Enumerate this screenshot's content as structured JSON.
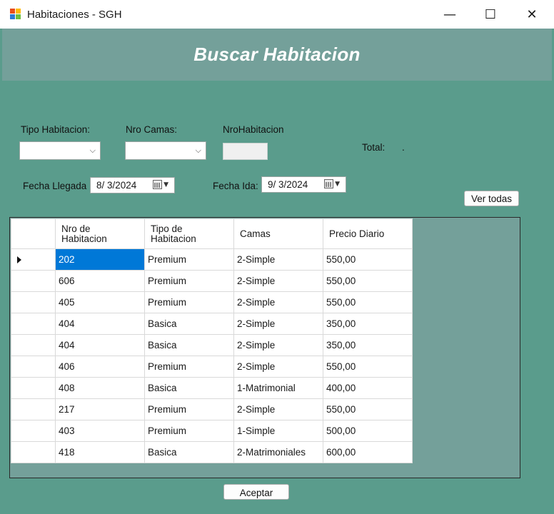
{
  "window": {
    "title": "Habitaciones - SGH",
    "minimize_glyph": "—",
    "maximize_glyph": "☐",
    "close_glyph": "✕",
    "icon_colors": [
      "#e84e1b",
      "#ffb900",
      "#2b7bd6",
      "#6fbf3f"
    ]
  },
  "banner": {
    "title": "Buscar Habitacion"
  },
  "filters": {
    "tipo_label": "Tipo Habitacion:",
    "camas_label": "Nro Camas:",
    "nro_label": "NroHabitacion",
    "total_label": "Total:",
    "total_value": ".",
    "llegada_label": "Fecha Llegada",
    "llegada_value": "8/  3/2024",
    "ida_label": "Fecha Ida:",
    "ida_value": "9/  3/2024",
    "combo_arrow": "⌵"
  },
  "buttons": {
    "ver_todas": "Ver todas",
    "aceptar": "Aceptar"
  },
  "table": {
    "headers": [
      "Nro de\nHabitacion",
      "Tipo de\nHabitacion",
      "Camas",
      "Precio Diario"
    ],
    "rows": [
      [
        "202",
        "Premium",
        "2-Simple",
        "550,00"
      ],
      [
        "606",
        "Premium",
        "2-Simple",
        "550,00"
      ],
      [
        "405",
        "Premium",
        "2-Simple",
        "550,00"
      ],
      [
        "404",
        "Basica",
        "2-Simple",
        "350,00"
      ],
      [
        "404",
        "Basica",
        "2-Simple",
        "350,00"
      ],
      [
        "406",
        "Premium",
        "2-Simple",
        "550,00"
      ],
      [
        "408",
        "Basica",
        "1-Matrimonial",
        "400,00"
      ],
      [
        "217",
        "Premium",
        "2-Simple",
        "550,00"
      ],
      [
        "403",
        "Premium",
        "1-Simple",
        "500,00"
      ],
      [
        "418",
        "Basica",
        "2-Matrimoniales",
        "600,00"
      ]
    ],
    "selected_row": 0
  }
}
